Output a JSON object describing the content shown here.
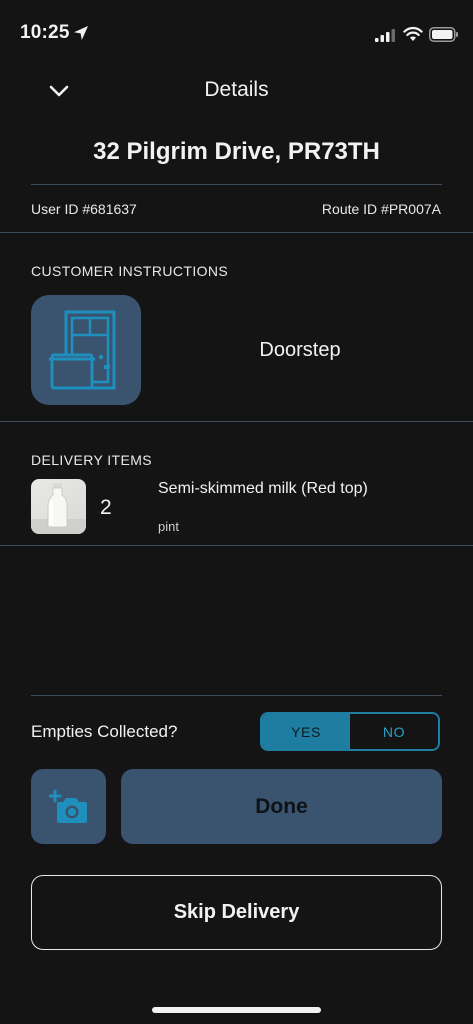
{
  "status_bar": {
    "time": "10:25",
    "icons": [
      "location-arrow-icon",
      "cellular-signal-icon",
      "wifi-icon",
      "battery-icon"
    ]
  },
  "header": {
    "title": "Details",
    "back_icon": "chevron-down-icon"
  },
  "address": "32 Pilgrim Drive, PR73TH",
  "ids": {
    "user_id": "User ID #681637",
    "route_id": "Route ID #PR007A"
  },
  "customer_instructions": {
    "label": "CUSTOMER INSTRUCTIONS",
    "icon": "doorstep-icon",
    "value": "Doorstep"
  },
  "delivery_items": {
    "label": "DELIVERY ITEMS",
    "items": [
      {
        "quantity": "2",
        "name": "Semi-skimmed milk (Red top)",
        "unit": "pint",
        "image": "milk-bottle-thumbnail"
      }
    ]
  },
  "empties": {
    "label": "Empties Collected?",
    "options": [
      "YES",
      "NO"
    ],
    "selected": "YES"
  },
  "actions": {
    "camera_icon": "add-photo-icon",
    "done_label": "Done",
    "skip_label": "Skip Delivery"
  },
  "colors": {
    "background": "#141415",
    "tile": "#3a5470",
    "accent": "#1e7ea1",
    "divider": "#3c4a5a"
  }
}
